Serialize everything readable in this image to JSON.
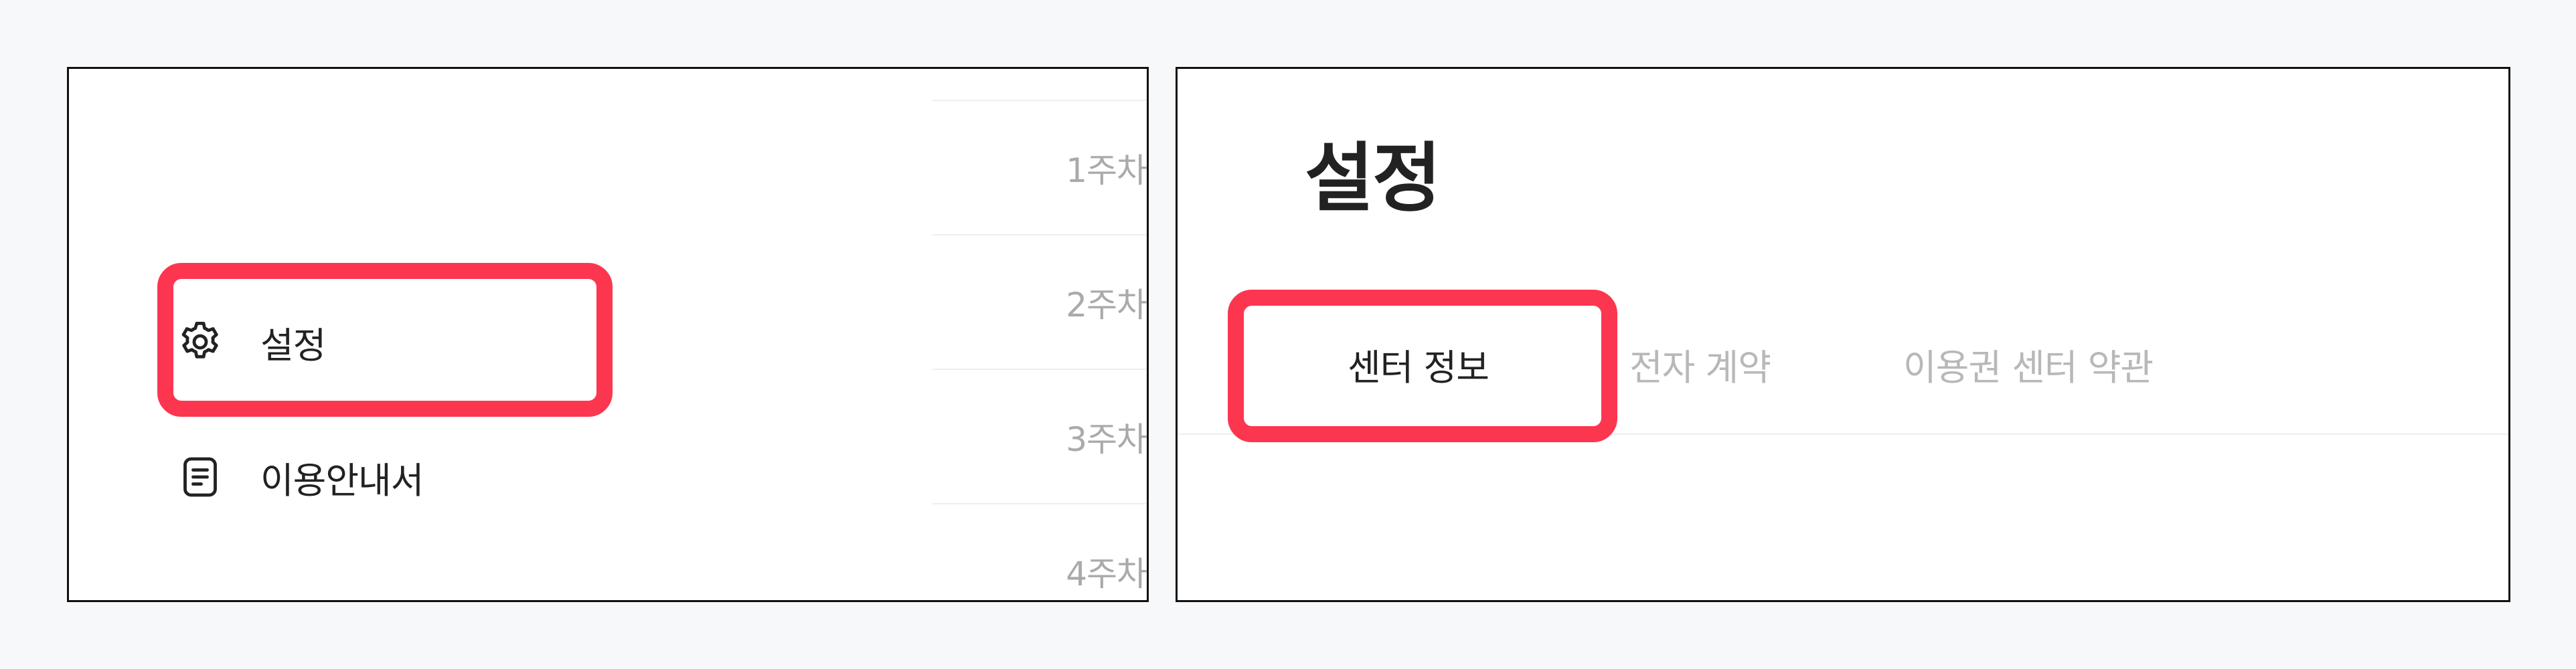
{
  "left_panel": {
    "weeks": [
      {
        "label": "1주차"
      },
      {
        "label": "2주차"
      },
      {
        "label": "3주차"
      },
      {
        "label": "4주차"
      }
    ],
    "menu": {
      "settings_label": "설정",
      "settings_icon": "gear-icon",
      "guide_label": "이용안내서",
      "guide_icon": "document-icon"
    }
  },
  "right_panel": {
    "title": "설정",
    "tabs": [
      {
        "label": "센터 정보",
        "active": true
      },
      {
        "label": "전자 계약",
        "active": false
      },
      {
        "label": "이용권 센터 약관",
        "active": false
      }
    ]
  },
  "colors": {
    "highlight": "#fd3650",
    "background": "#f7f8fa",
    "muted_text": "#aaaaaa",
    "primary_text": "#222222"
  }
}
